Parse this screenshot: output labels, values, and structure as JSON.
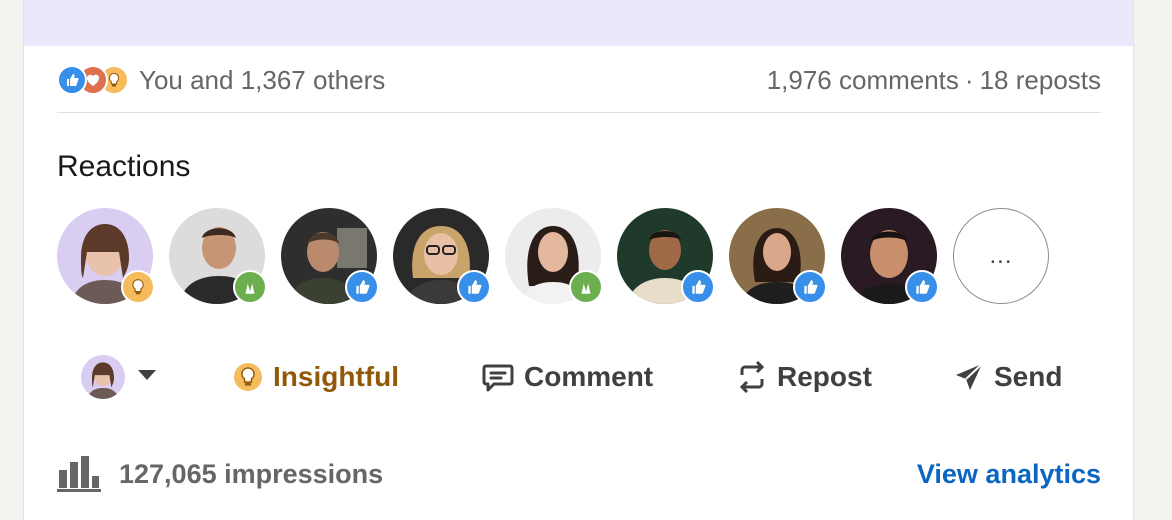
{
  "social": {
    "reactions_text": "You and 1,367 others",
    "comments_text": "1,976 comments",
    "separator": "·",
    "reposts_text": "18 reposts"
  },
  "reactions": {
    "title": "Reactions",
    "more_label": "...",
    "people": [
      {
        "reaction": "insightful-icon"
      },
      {
        "reaction": "celebrate-icon"
      },
      {
        "reaction": "like-icon"
      },
      {
        "reaction": "like-icon"
      },
      {
        "reaction": "celebrate-icon"
      },
      {
        "reaction": "like-icon"
      },
      {
        "reaction": "like-icon"
      },
      {
        "reaction": "like-icon"
      }
    ]
  },
  "actions": {
    "insightful_label": "Insightful",
    "comment_label": "Comment",
    "repost_label": "Repost",
    "send_label": "Send"
  },
  "analytics": {
    "impressions_text": "127,065 impressions",
    "view_label": "View analytics"
  },
  "colors": {
    "banner": "#ebe8fc",
    "link": "#0a66c2",
    "insightful": "#915907",
    "like": "#378fe9",
    "celebrate": "#6dae4f",
    "love": "#df704d",
    "insight_badge": "#f5bb5c"
  }
}
